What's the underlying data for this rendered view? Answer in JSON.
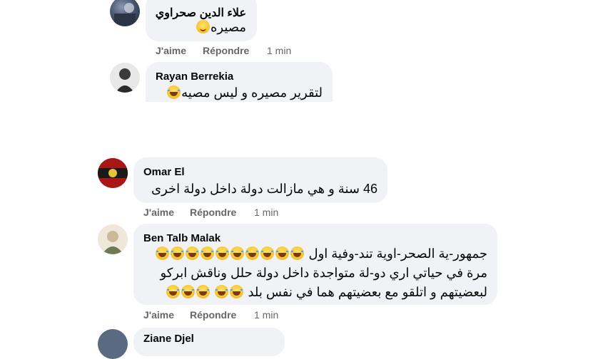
{
  "comments": [
    {
      "author": "علاء الدين صحراوي",
      "text": "مصيره",
      "emoji": "smiling-face",
      "actions": {
        "like": "J'aime",
        "reply": "Répondre",
        "time": "1 min"
      }
    },
    {
      "author": "Rayan Berrekia",
      "text": "لتقرير مصيره و ليس مصيه",
      "emoji": "laughing-face"
    },
    {
      "author": "Omar El",
      "text": "46 سنة و هي مازالت دولة داخل دولة اخرى",
      "actions": {
        "like": "J'aime",
        "reply": "Répondre",
        "time": "1 min"
      }
    },
    {
      "author": "Ben Talb Malak",
      "lines": [
        "جمهور-ية الصحر-اوية تند-وفية اول",
        "مرة في حياتي اري دو-لة متواجدة داخل دولة حلل وناقش ابركو",
        "لبعضيتهم و اتلقو مع بعضيتهم هما في نفس بلد"
      ],
      "emoji": "laughing-face",
      "actions": {
        "like": "J'aime",
        "reply": "Répondre",
        "time": "1 min"
      }
    },
    {
      "author": "Ziane Djel"
    }
  ],
  "colors": {
    "bubble": "#f0f2f5",
    "meta_text": "#65676b",
    "text": "#050505"
  }
}
